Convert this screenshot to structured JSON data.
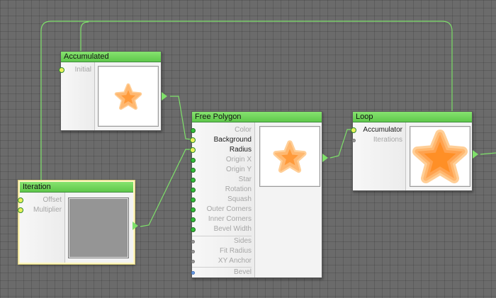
{
  "nodes": {
    "accumulated": {
      "title": "Accumulated",
      "ports": [
        "Initial"
      ]
    },
    "free_polygon": {
      "title": "Free Polygon",
      "ports": [
        "Color",
        "Background",
        "Radius",
        "Origin X",
        "Origin Y",
        "Star",
        "Rotation",
        "Squash",
        "Outer Corners",
        "Inner Corners",
        "Bevel Width",
        "Sides",
        "Fit Radius",
        "XY Anchor",
        "Bevel"
      ]
    },
    "loop": {
      "title": "Loop",
      "ports": [
        "Accumulator",
        "Iterations"
      ]
    },
    "iteration": {
      "title": "Iteration",
      "ports": [
        "Offset",
        "Multiplier"
      ]
    }
  },
  "colors": {
    "canvas": "#6b6b6b",
    "title_bar": "#6fd35a",
    "wire": "#7ee06a",
    "star_light": "#ffcf98",
    "star_mid": "#ffb870",
    "star_dark": "#ff9a3a",
    "iteration_preview": "#959595"
  }
}
